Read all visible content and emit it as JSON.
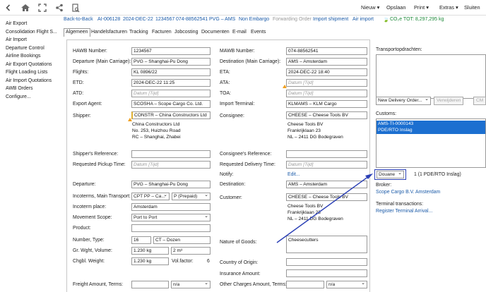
{
  "toolbar": {
    "icons": [
      "back-icon",
      "home-icon",
      "expand-icon",
      "share-icon",
      "print-preview-icon"
    ],
    "new_label": "Nieuw",
    "save_label": "Opslaan",
    "print_label": "Print",
    "extras_label": "Extras",
    "close_label": "Sluiten"
  },
  "sidebar": {
    "items": [
      {
        "label": "Air Export"
      },
      {
        "label": "Consolidation Flight S..."
      },
      {
        "label": "Air Import"
      },
      {
        "label": "Departure Control"
      },
      {
        "label": "Airline Bookings"
      },
      {
        "label": "Air Export Quotations"
      },
      {
        "label": "Flight Loading Lists"
      },
      {
        "label": "Air Import Quotations"
      },
      {
        "label": "AWB Orders"
      },
      {
        "label": "Configure..."
      }
    ]
  },
  "breadcrumb": {
    "back_to_back": "Back-to-Back",
    "file_no": "AI-006128",
    "date": "2024-DEC-22",
    "hawb": "1234567",
    "mawb": "074-88562541",
    "route": "PVG – AMS",
    "embargo": "Non Embargo",
    "forwarding": "Forwarding Order",
    "import_shipment": "Import shipment",
    "air_import": "Air import",
    "co2": "CO₂e TOT: 8,297,295 kg"
  },
  "tabs": [
    "Algemeen",
    "Handelsfacturen",
    "Tracking",
    "Facturen",
    "Jobcosting",
    "Documenten",
    "E-mail",
    "Events"
  ],
  "form": {
    "hawb_label": "HAWB Number:",
    "hawb_value": "1234567",
    "departure_main_label": "Departure (Main Carriage):",
    "departure_main_value": "PVG – Shanghai-Pu Dong",
    "flights_label": "Flights:",
    "flights_value": "KL 0896/22",
    "etd_label": "ETD:",
    "etd_value": "2024-DEC-22 11:25",
    "atd_label": "ATD:",
    "atd_placeholder": "Datum [Tijd]",
    "export_agent_label": "Export Agent:",
    "export_agent_value": "SCOSHA – Scope Cargo Co. Ltd.",
    "shipper_label": "Shipper:",
    "shipper_value": "CONSTR – China Constructors Ltd",
    "shipper_address": "China Constructors Ltd\nNo. 253, Huizhou Road\nRC – Shanghai, Zhabei",
    "shipper_ref_label": "Shipper's Reference:",
    "req_pickup_label": "Requested Pickup Time:",
    "req_pickup_placeholder": "Datum [Tijd]",
    "departure_label": "Departure:",
    "departure_value": "PVG – Shanghai-Pu Dong",
    "incoterms_main_label": "Incoterms, Main Transport:",
    "incoterms_value": "CPT PP – Ca...",
    "incoterms_payment": "P (Prepaid)",
    "incoterm_place_label": "Incoterm place:",
    "incoterm_place_value": "Amsterdam",
    "movement_scope_label": "Movement Scope:",
    "movement_scope_value": "Port to Port",
    "product_label": "Product:",
    "number_type_label": "Number, Type:",
    "number_value": "16",
    "type_value": "CT – Dozen",
    "gr_wght_label": "Gr. Wght, Volume:",
    "gr_wght_value": "1.230 kg",
    "volume_value": "2 m³",
    "chgbl_label": "Chgbl. Weight:",
    "chgbl_value": "1.230 kg",
    "volfactor_label": "Vol.factor:",
    "volfactor_value": "6",
    "freight_label": "Freight Amount, Terms:",
    "freight_terms": "n/a",
    "mawb_label": "MAWB Number:",
    "mawb_value": "074-88562541",
    "destination_main_label": "Destination (Main Carriage):",
    "destination_main_value": "AMS – Amsterdam",
    "eta_label": "ETA:",
    "eta_value": "2024-DEC-22 18:40",
    "ata_label": "ATA:",
    "ata_placeholder": "Datum [Tijd]",
    "toa_label": "TOA:",
    "toa_placeholder": "Datum [Tijd]",
    "import_terminal_label": "Import Terminal:",
    "import_terminal_value": "KLMAMS – KLM Cargo",
    "consignee_label": "Consignee:",
    "consignee_value": "CHEESE – Cheese Tools BV",
    "consignee_address": "Cheese Tools BV\nFrankrijklaan 23\nNL – 2411 DG Bodegraven",
    "consignee_ref_label": "Consignee's Reference:",
    "req_delivery_label": "Requested Delivery Time:",
    "req_delivery_placeholder": "Datum [Tijd]",
    "notify_label": "Notify:",
    "notify_link": "Edit...",
    "destination_label": "Destination:",
    "destination_value": "AMS – Amsterdam",
    "customer_label": "Customer:",
    "customer_value": "CHEESE – Cheese Tools BV",
    "customer_address": "Cheese Tools BV\nFrankrijklaan 23\nNL – 2411 DG Bodegraven",
    "nature_goods_label": "Nature of Goods:",
    "nature_goods_value": "Cheesecutters",
    "country_origin_label": "Country of Origin:",
    "insurance_label": "Insurance Amount:",
    "other_charges_label": "Other Charges Amount, Terms:",
    "other_charges_terms": "n/a"
  },
  "right": {
    "transport_label": "Transportopdrachten:",
    "new_delivery_order": "New Delivery Order...",
    "delete_label": "Verwijderen",
    "cm_label": "CM",
    "customs_label": "Customs:",
    "customs_entry": "AMS-TI-0000143\nPDE/RTO Inslag",
    "customs_type": "Douane",
    "customs_count": "1 (1 PDE/RTO Inslag)",
    "broker_label": "Broker:",
    "broker_link": "Scope Cargo B.V. Amsterdam",
    "terminal_label": "Terminal transactions:",
    "terminal_link": "Register Terminal Arrival..."
  },
  "colors": {
    "link": "#1a5aa8",
    "selection": "#1c6fd0",
    "highlight_box": "#2a3fb5",
    "arrow": "#2a3fb5"
  }
}
